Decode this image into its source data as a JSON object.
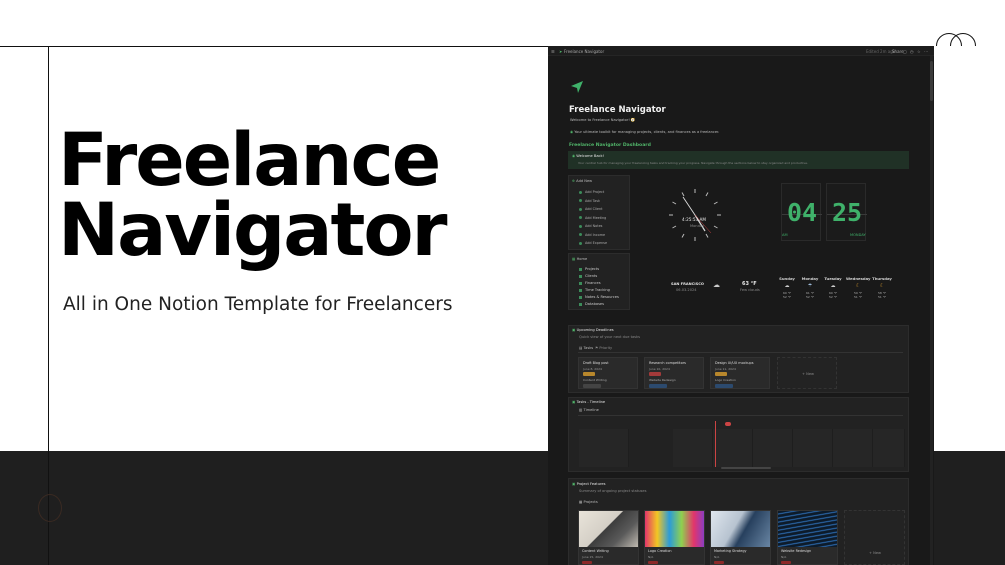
{
  "hero": {
    "title_line1": "Freelance",
    "title_line2": "Navigator",
    "subtitle": "All in One Notion Template for Freelancers"
  },
  "colors": {
    "accent": "#3fb16a",
    "dark_bg": "#191919",
    "band": "#1f1f1f"
  },
  "app": {
    "breadcrumb": "Freelance Navigator",
    "topbar_edited": "Edited 2m ago",
    "topbar_share": "Share",
    "page_title": "Freelance Navigator",
    "welcome_line": "Welcome to Freelance Navigator! 🧭",
    "callout": "Your ultimate toolkit for managing projects, clients, and finances as a freelancer.",
    "dashboard_heading": "Freelance Navigator Dashboard",
    "welcome_back_title": "Welcome Back!",
    "welcome_back_text": "Your central hub for managing your freelancing tasks and tracking your progress. Navigate through the sections below to stay organized and productive.",
    "add_new": {
      "title": "Add New",
      "items": [
        "Add Project",
        "Add Task",
        "Add Client",
        "Add Meeting",
        "Add Notes",
        "Add Income",
        "Add Expense"
      ]
    },
    "home": {
      "title": "Home",
      "items": [
        "Projects",
        "Clients",
        "Finances",
        "Time Tracking",
        "Notes & Resources",
        "Databases"
      ]
    },
    "clock": {
      "time": "4:25:53 AM",
      "day": "Monday"
    },
    "flip_clock": {
      "hour": "04",
      "minute": "25",
      "ampm": "AM",
      "weekday": "MONDAY"
    },
    "weather": {
      "city": "SAN FRANCISCO",
      "date": "06.03.2024",
      "temp": "63 °F",
      "condition": "Few clouds",
      "forecast": [
        {
          "day": "Sunday",
          "icon": "cloud-sun",
          "hi": "60 °F",
          "lo": "52 °F"
        },
        {
          "day": "Monday",
          "icon": "cloud-rain",
          "hi": "61 °F",
          "lo": "52 °F"
        },
        {
          "day": "Tuesday",
          "icon": "cloud",
          "hi": "60 °F",
          "lo": "52 °F"
        },
        {
          "day": "Wednesday",
          "icon": "moon",
          "hi": "59 °F",
          "lo": "51 °F"
        },
        {
          "day": "Thursday",
          "icon": "moon",
          "hi": "58 °F",
          "lo": "51 °F"
        }
      ]
    },
    "deadlines": {
      "title": "Upcoming Deadlines",
      "subtitle": "Quick view of your next due tasks",
      "tabs": [
        "Tasks",
        "Priority"
      ],
      "cards": [
        {
          "title": "Draft Blog post",
          "date": "June 8, 2024",
          "tag_color": "#b8872c",
          "assignee": "Content Writing",
          "chip": "To Do"
        },
        {
          "title": "Research competitors",
          "date": "June 10, 2024",
          "tag_color": "#a33a3a",
          "assignee": "Website Redesign",
          "chip": "In progress"
        },
        {
          "title": "Design UI/UX mockups",
          "date": "June 11, 2024",
          "tag_color": "#b8872c",
          "assignee": "Logo Creation",
          "chip": "In progress"
        }
      ],
      "new_label": "+ New"
    },
    "timeline": {
      "title": "Tasks - Timeline",
      "view": "Timeline"
    },
    "features": {
      "title": "Project Features",
      "subtitle": "Summary of ongoing project statuses",
      "view": "Projects",
      "gallery": [
        {
          "title": "Content Writing",
          "date": "June 15, 2024",
          "img": "laptop"
        },
        {
          "title": "Logo Creation",
          "date": "N/A",
          "img": "color"
        },
        {
          "title": "Marketing Strategy",
          "date": "N/A",
          "img": "office"
        },
        {
          "title": "Website Redesign",
          "date": "N/A",
          "img": "code"
        }
      ],
      "new_label": "+ New"
    }
  }
}
